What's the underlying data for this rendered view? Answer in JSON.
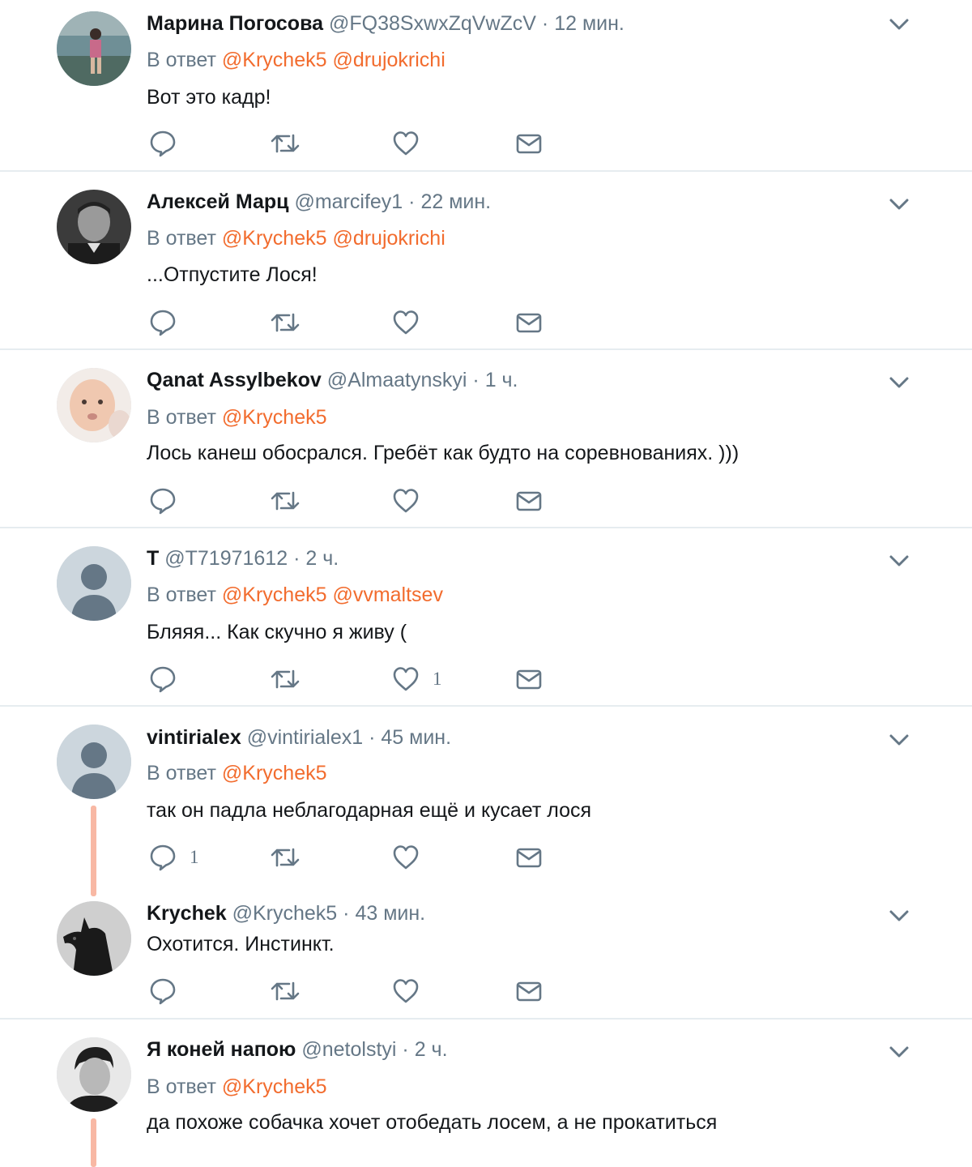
{
  "reply_prefix": "В ответ",
  "colors": {
    "accent": "#f26c2e",
    "muted": "#657786",
    "text": "#14171a",
    "divider": "#e6ecf0",
    "thread": "#f8b8a4"
  },
  "icons": [
    "reply-icon",
    "retweet-icon",
    "like-icon",
    "direct-message-icon",
    "chevron-down-icon"
  ],
  "tweets": [
    {
      "name": "Марина Погосова",
      "handle": "@FQ38SxwxZqVwZcV",
      "time": "12 мин.",
      "mentions": [
        "@Krychek5",
        "@drujokrichi"
      ],
      "text": "Вот это кадр!",
      "avatar": "photo-person-at-sea",
      "reply_count": "",
      "like_count": ""
    },
    {
      "name": "Алексей Марц",
      "handle": "@marcifey1",
      "time": "22 мин.",
      "mentions": [
        "@Krychek5",
        "@drujokrichi"
      ],
      "text": "...Отпустите Лося!",
      "avatar": "photo-man-bw",
      "reply_count": "",
      "like_count": ""
    },
    {
      "name": "Qanat Assylbekov",
      "handle": "@Almaatynskyi",
      "time": "1 ч.",
      "mentions": [
        "@Krychek5"
      ],
      "text": "Лось канеш обосрался. Гребёт как будто на соревнованиях. )))",
      "avatar": "photo-baby",
      "reply_count": "",
      "like_count": ""
    },
    {
      "name": "T",
      "handle": "@T71971612",
      "time": "2 ч.",
      "mentions": [
        "@Krychek5",
        "@vvmaltsev"
      ],
      "text": "Бляяя... Как скучно я живу (",
      "avatar": "default-avatar",
      "reply_count": "",
      "like_count": "1"
    },
    {
      "name": "vintirialex",
      "handle": "@vintirialex1",
      "time": "45 мин.",
      "mentions": [
        "@Krychek5"
      ],
      "text": "так он падла неблагодарная ещё и кусает лося",
      "avatar": "default-avatar",
      "reply_count": "1",
      "like_count": ""
    },
    {
      "name": "Krychek",
      "handle": "@Krychek5",
      "time": "43 мин.",
      "mentions": [],
      "text": "Охотится. Инстинкт.",
      "avatar": "photo-great-dane",
      "reply_count": "",
      "like_count": ""
    },
    {
      "name": "Я коней напою",
      "handle": "@netolstyi",
      "time": "2 ч.",
      "mentions": [
        "@Krychek5"
      ],
      "text": "да похоже собачка хочет отобедать лосем, а не прокатиться",
      "avatar": "photo-man-portrait-bw",
      "reply_count": "",
      "like_count": ""
    }
  ]
}
